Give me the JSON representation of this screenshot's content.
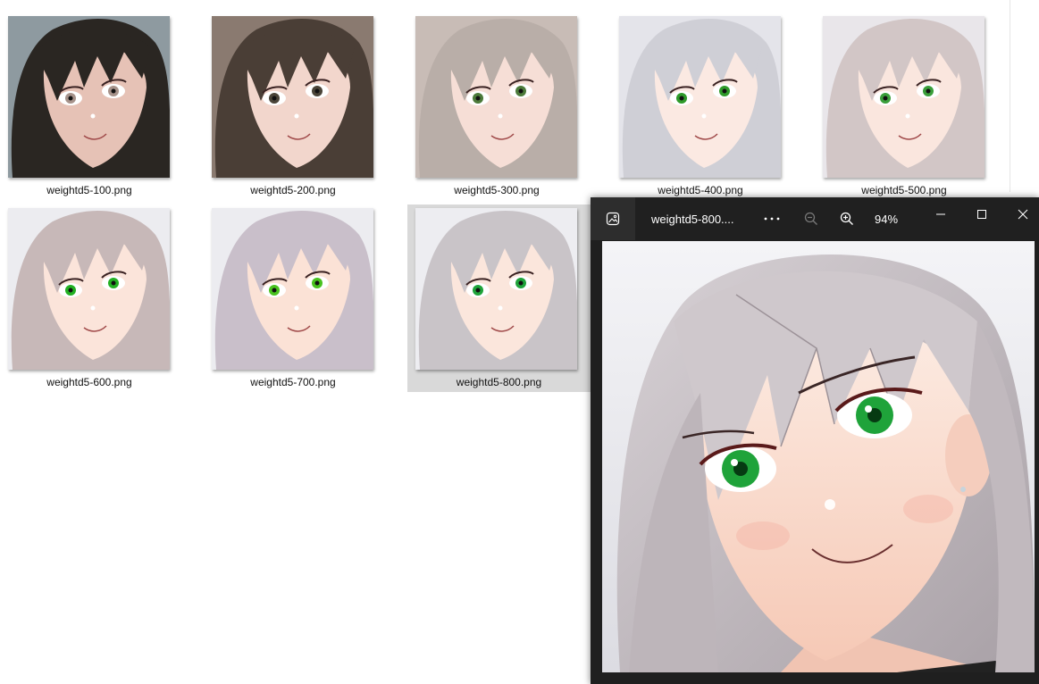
{
  "explorer": {
    "files": [
      {
        "name": "weightd5-100.png",
        "hair": "#2a2622",
        "bg": "#8e9aa0",
        "skin": "#e6c2b6",
        "eyes": "#a6928a",
        "selected": false
      },
      {
        "name": "weightd5-200.png",
        "hair": "#4a3e36",
        "bg": "#8a7a70",
        "skin": "#f2d6cc",
        "eyes": "#4a4438",
        "selected": false
      },
      {
        "name": "weightd5-300.png",
        "hair": "#b9aea8",
        "bg": "#c8bcb6",
        "skin": "#f6ded6",
        "eyes": "#4c7a3a",
        "selected": false
      },
      {
        "name": "weightd5-400.png",
        "hair": "#cfcfd6",
        "bg": "#e4e4ea",
        "skin": "#fbe9e2",
        "eyes": "#2f9a2a",
        "selected": false
      },
      {
        "name": "weightd5-500.png",
        "hair": "#d2c6c6",
        "bg": "#e9e6ea",
        "skin": "#fae6de",
        "eyes": "#3a9e3a",
        "selected": false
      },
      {
        "name": "weightd5-600.png",
        "hair": "#c7b8b8",
        "bg": "#ececf0",
        "skin": "#fbe4da",
        "eyes": "#23b023",
        "selected": false
      },
      {
        "name": "weightd5-700.png",
        "hair": "#c9bfca",
        "bg": "#ececf0",
        "skin": "#fbe2d6",
        "eyes": "#49c21f",
        "selected": false
      },
      {
        "name": "weightd5-800.png",
        "hair": "#c9c4c8",
        "bg": "#ededf1",
        "skin": "#fbe6dc",
        "eyes": "#1fa33a",
        "selected": true
      }
    ]
  },
  "viewer": {
    "title": "weightd5-800....",
    "zoom": "94%",
    "icons": {
      "app": "photos-app-icon",
      "more": "more-options-icon",
      "zoom_out": "zoom-out-icon",
      "zoom_in": "zoom-in-icon",
      "minimize": "minimize-icon",
      "maximize": "maximize-icon",
      "close": "close-icon"
    },
    "colors": {
      "titlebar": "#202020",
      "icon_box": "#2d2d2d",
      "text": "#ffffff"
    }
  }
}
